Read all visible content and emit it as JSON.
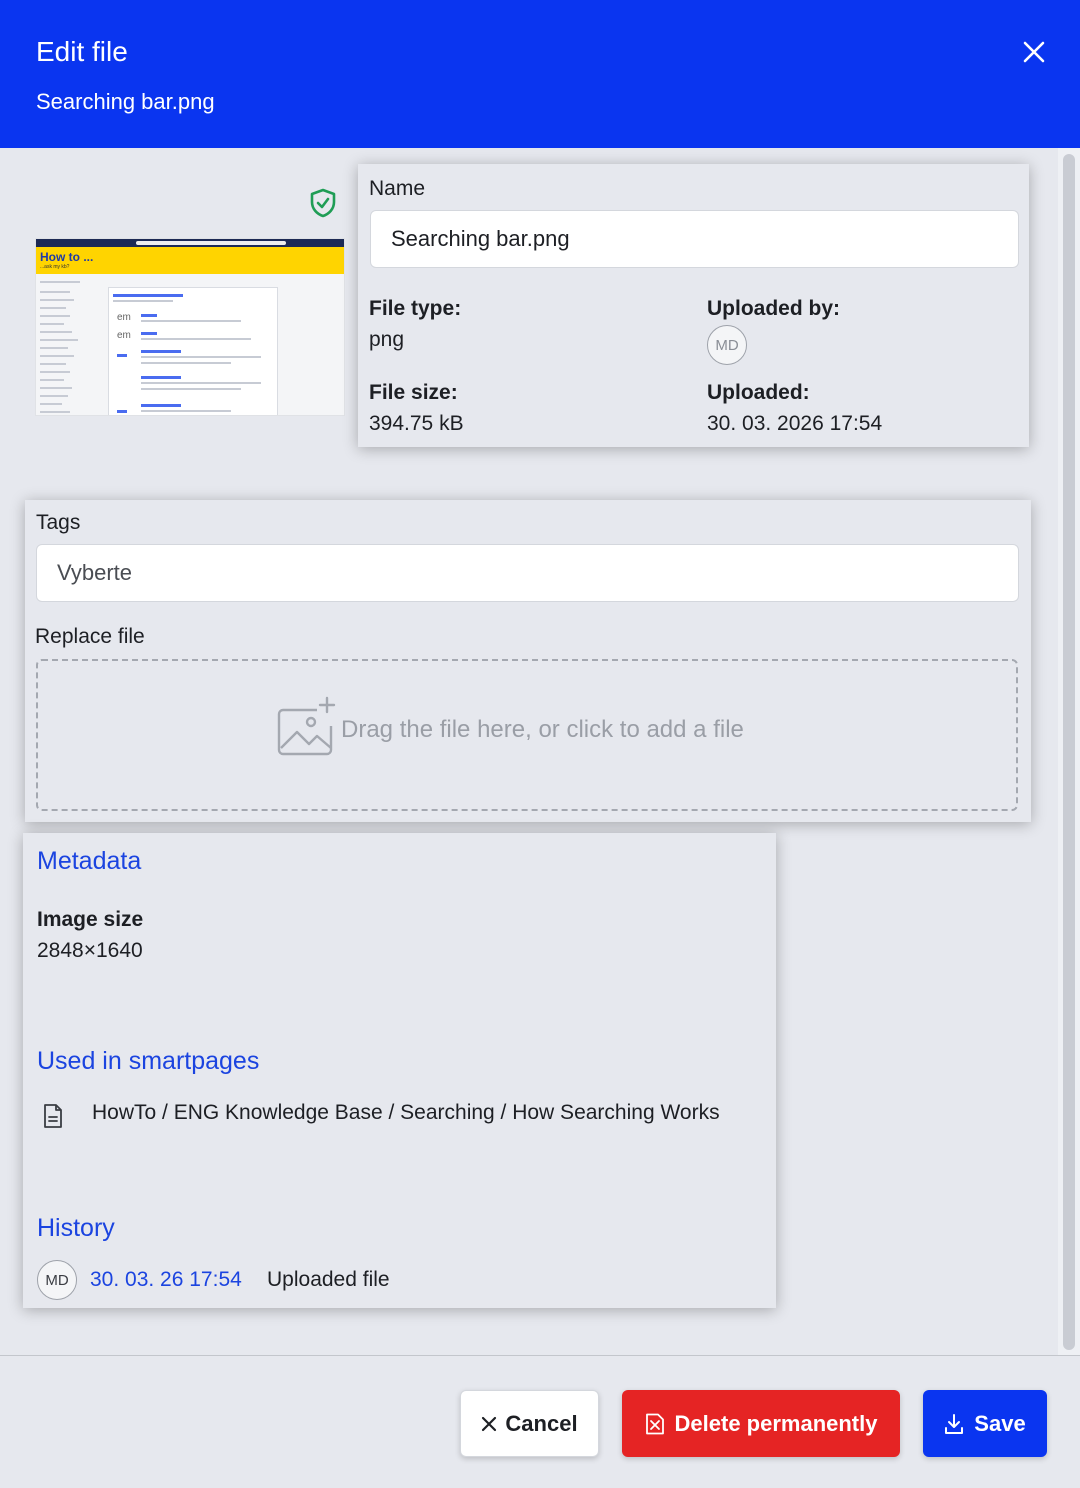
{
  "dialog": {
    "title": "Edit file",
    "subtitle": "Searching bar.png"
  },
  "preview": {
    "thumbnail_title": "How to ...",
    "thumbnail_subtitle": "...ask my kb?",
    "thumbnail_em": "em"
  },
  "details": {
    "name_label": "Name",
    "name_value": "Searching bar.png",
    "file_type_label": "File type:",
    "file_type_value": "png",
    "uploaded_by_label": "Uploaded by:",
    "uploaded_by_initials": "MD",
    "file_size_label": "File size:",
    "file_size_value": "394.75 kB",
    "uploaded_label": "Uploaded:",
    "uploaded_value": "30. 03. 2026 17:54"
  },
  "tags": {
    "label": "Tags",
    "placeholder": "Vyberte",
    "replace_label": "Replace file",
    "drop_text": "Drag the file here, or click to add a file"
  },
  "metadata": {
    "heading": "Metadata",
    "image_size_label": "Image size",
    "image_size_value": "2848×1640",
    "used_heading": "Used in smartpages",
    "used_path": "HowTo / ENG Knowledge Base / Searching / How Searching Works",
    "history_heading": "History",
    "history_initials": "MD",
    "history_date": "30. 03. 26 17:54",
    "history_action": "Uploaded file"
  },
  "buttons": {
    "cancel": "Cancel",
    "delete": "Delete permanently",
    "save": "Save"
  },
  "colors": {
    "primary": "#0a35f0",
    "danger": "#e52424",
    "link": "#1b44e0",
    "shield": "#1f9d55"
  }
}
